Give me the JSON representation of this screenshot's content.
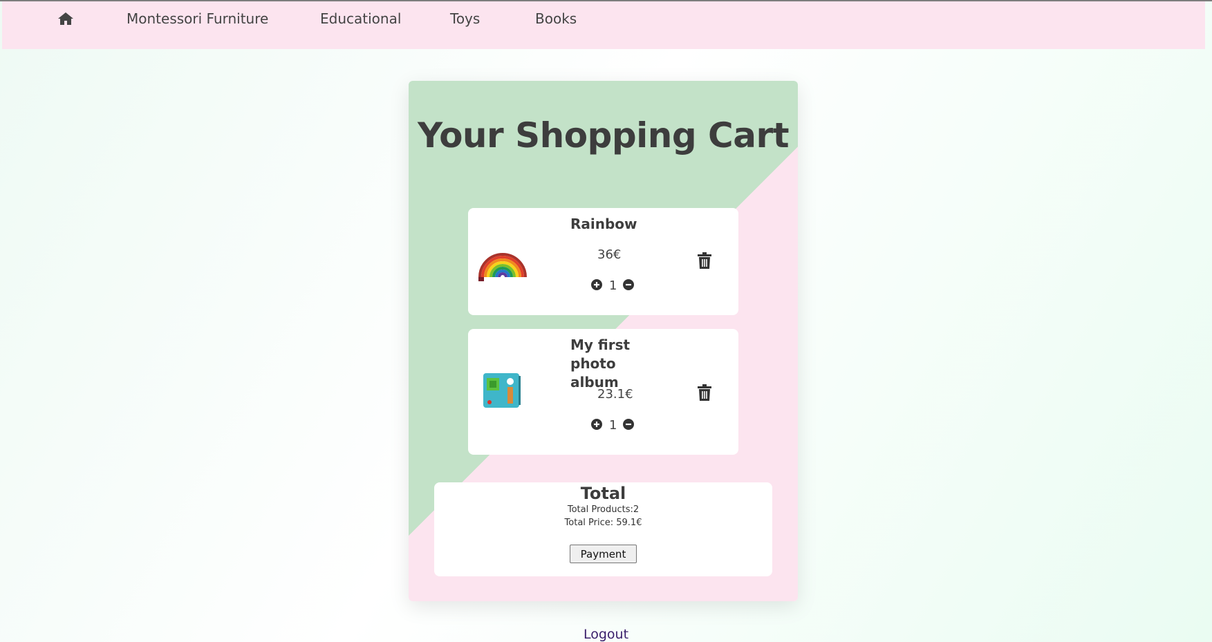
{
  "nav": {
    "home_icon": "home-icon",
    "links": [
      "Montessori Furniture",
      "Educational",
      "Toys",
      "Books"
    ]
  },
  "cart": {
    "title": "Your Shopping Cart",
    "items": [
      {
        "name": "Rainbow",
        "price": "36€",
        "quantity": "1",
        "image": "rainbow-toy-image"
      },
      {
        "name": "My first photo album",
        "price": "23.1€",
        "quantity": "1",
        "image": "photo-album-image"
      }
    ],
    "total": {
      "title": "Total",
      "products_line": "Total Products:2",
      "price_line": "Total Price: 59.1€",
      "payment_label": "Payment"
    }
  },
  "logout_label": "Logout",
  "colors": {
    "navbar_bg": "#fce4ef",
    "card_green": "#c3e2c8",
    "card_pink": "#fce4ef",
    "text_dark": "#3d3d3d",
    "logout_link": "#3a1e6b"
  }
}
